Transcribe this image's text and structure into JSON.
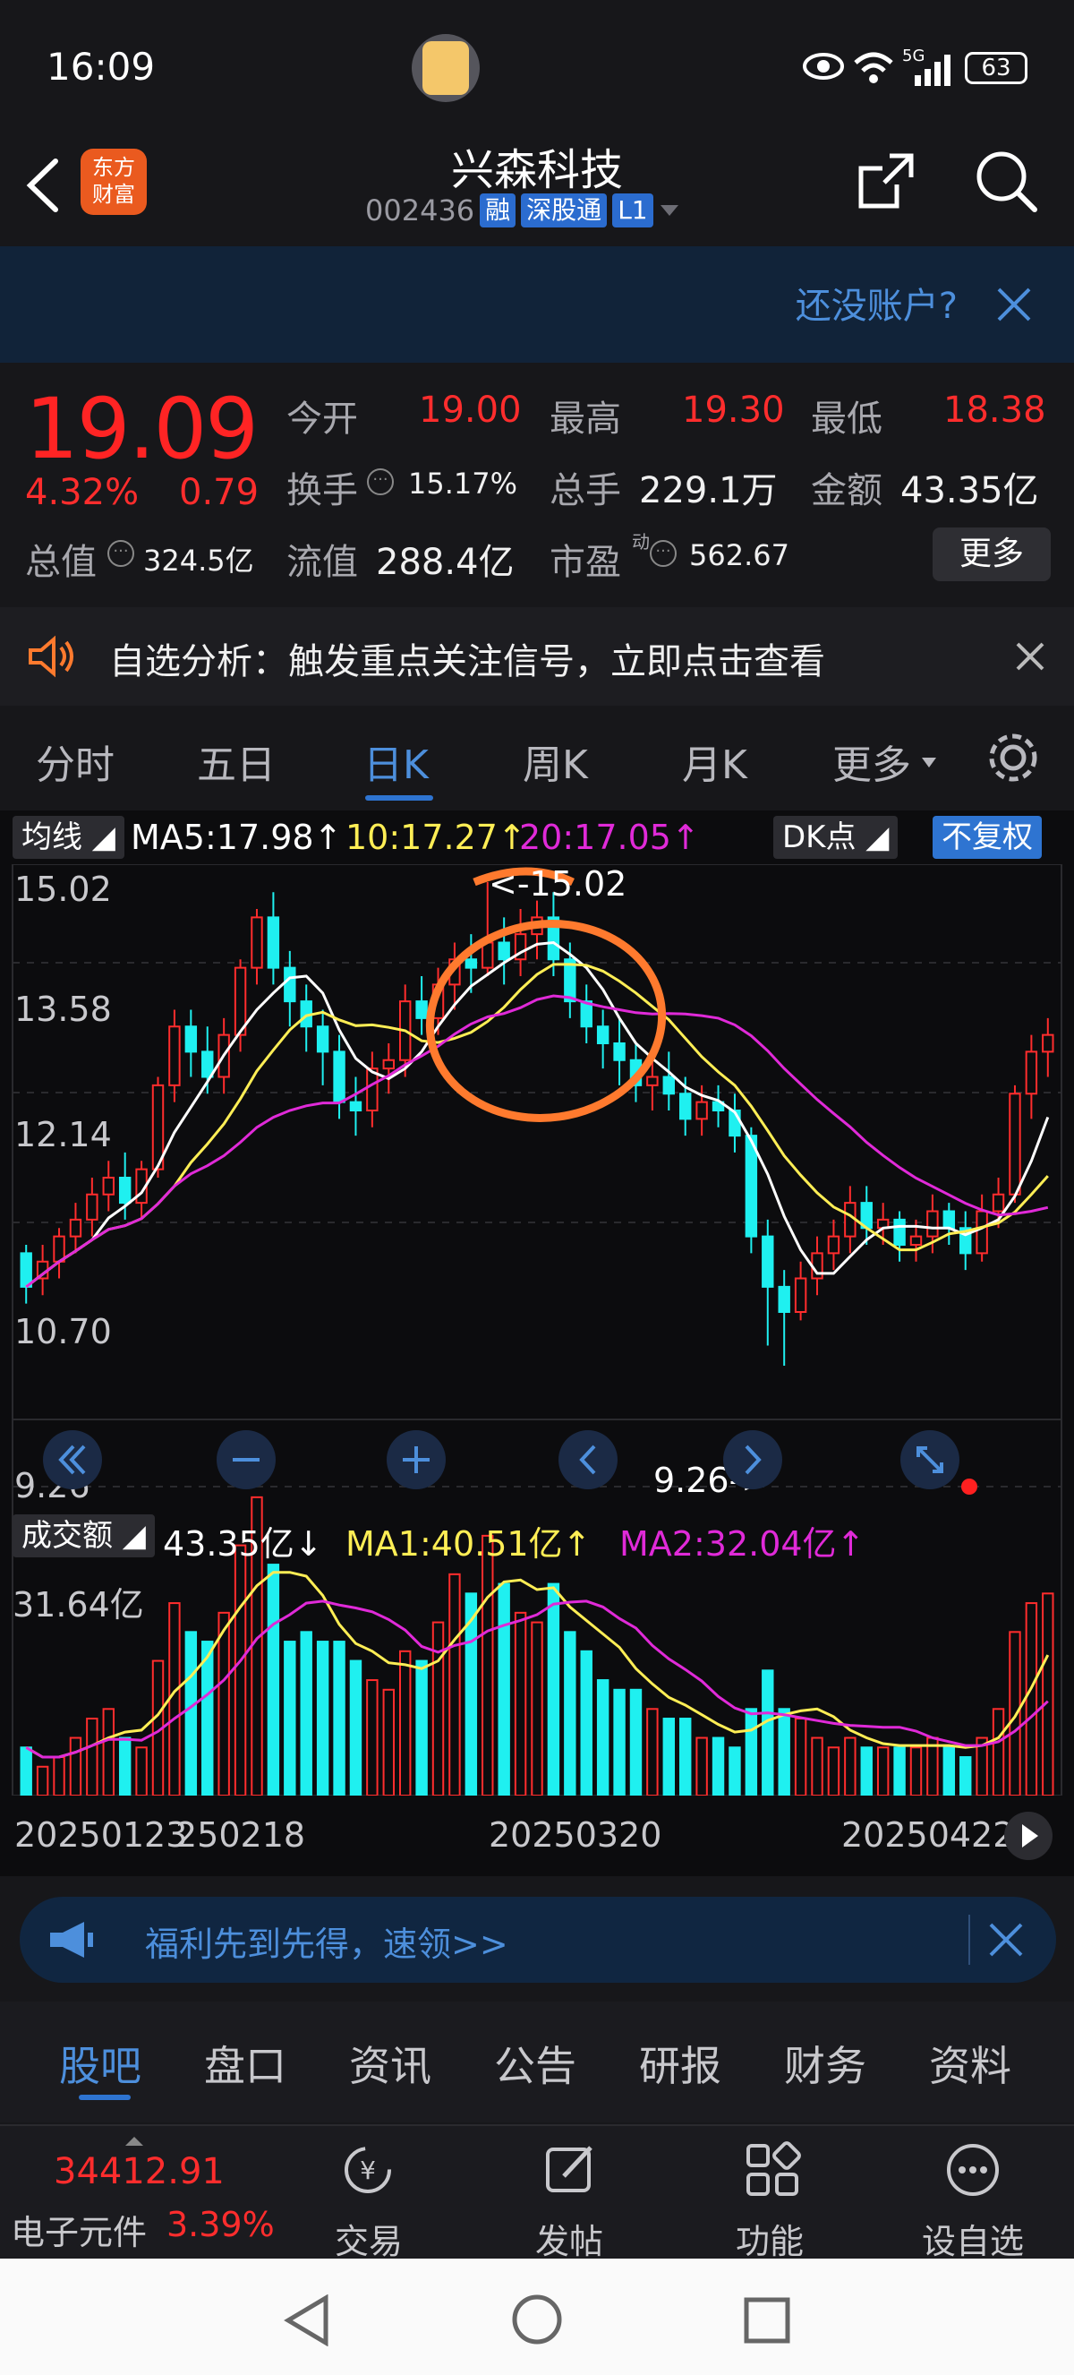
{
  "status": {
    "time": "16:09",
    "network": "5G",
    "battery": "63"
  },
  "header": {
    "title": "兴森科技",
    "code": "002436",
    "tags": [
      "融",
      "深股通",
      "L1"
    ],
    "logo_line1": "东方",
    "logo_line2": "财富"
  },
  "banner": {
    "text": "还没账户?"
  },
  "quote": {
    "price": "19.09",
    "change_pct": "4.32%",
    "change": "0.79",
    "open_label": "今开",
    "open": "19.00",
    "high_label": "最高",
    "high": "19.30",
    "low_label": "最低",
    "low": "18.38",
    "turnover_label": "换手",
    "turnover": "15.17%",
    "volume_label": "总手",
    "volume": "229.1万",
    "amount_label": "金额",
    "amount": "43.35亿",
    "mktcap_label": "总值",
    "mktcap": "324.5亿",
    "float_label": "流值",
    "float": "288.4亿",
    "pe_label": "市盈",
    "pe_sup": "动",
    "pe": "562.67",
    "more": "更多"
  },
  "analysis": {
    "text": "自选分析：触发重点关注信号，立即点击查看"
  },
  "tabs": [
    "分时",
    "五日",
    "日K",
    "周K",
    "月K",
    "更多"
  ],
  "active_tab": "日K",
  "chart": {
    "indicator_chip": "均线",
    "ma5": "MA5:17.98↑",
    "ma10": "10:17.27↑",
    "ma20": "20:17.05↑",
    "dk_chip": "DK点",
    "adjust_chip": "不复权",
    "y_labels": [
      "15.02",
      "13.58",
      "12.14",
      "10.70",
      "9.26"
    ],
    "high_marker": "<-15.02",
    "low_marker": "9.26->",
    "vol_chip": "成交额",
    "vol_value": "43.35亿↓",
    "vol_ma1": "MA1:40.51亿↑",
    "vol_ma2": "MA2:32.04亿↑",
    "vol_max": "31.64亿",
    "x_labels": [
      "20250123",
      "250218",
      "20250320",
      "20250422"
    ],
    "colors": {
      "up": "#ff2d2d",
      "down": "#1ff0f0",
      "ma5": "#ffffff",
      "ma10": "#ffee55",
      "ma20": "#e02ad8",
      "annotation": "#ff7a2e"
    }
  },
  "chart_data": {
    "type": "candlestick",
    "ylim": [
      9.26,
      15.02
    ],
    "candles": [
      [
        10.6,
        10.2,
        10.7,
        10.0
      ],
      [
        10.3,
        10.5,
        10.7,
        10.1
      ],
      [
        10.5,
        10.8,
        10.9,
        10.3
      ],
      [
        10.8,
        11.0,
        11.2,
        10.6
      ],
      [
        11.0,
        11.3,
        11.5,
        10.8
      ],
      [
        11.3,
        11.5,
        11.7,
        11.1
      ],
      [
        11.5,
        11.2,
        11.8,
        11.0
      ],
      [
        11.2,
        11.6,
        11.7,
        11.0
      ],
      [
        11.6,
        12.6,
        12.7,
        11.5
      ],
      [
        12.6,
        13.3,
        13.5,
        12.4
      ],
      [
        13.3,
        13.0,
        13.5,
        12.7
      ],
      [
        13.0,
        12.7,
        13.3,
        12.5
      ],
      [
        12.7,
        13.2,
        13.4,
        12.5
      ],
      [
        13.2,
        14.0,
        14.1,
        13.0
      ],
      [
        14.0,
        14.6,
        14.7,
        13.8
      ],
      [
        14.6,
        14.0,
        14.9,
        13.8
      ],
      [
        14.0,
        13.6,
        14.2,
        13.3
      ],
      [
        13.6,
        13.3,
        13.8,
        13.0
      ],
      [
        13.3,
        13.0,
        13.5,
        12.6
      ],
      [
        13.0,
        12.4,
        13.2,
        12.2
      ],
      [
        12.4,
        12.3,
        12.7,
        12.0
      ],
      [
        12.3,
        12.8,
        13.0,
        12.1
      ],
      [
        12.8,
        12.9,
        13.1,
        12.5
      ],
      [
        12.9,
        13.6,
        13.8,
        12.7
      ],
      [
        13.6,
        13.4,
        13.9,
        13.2
      ],
      [
        13.4,
        13.8,
        14.0,
        13.2
      ],
      [
        13.8,
        14.1,
        14.3,
        13.5
      ],
      [
        14.1,
        14.0,
        14.4,
        13.7
      ],
      [
        14.0,
        14.3,
        15.02,
        13.9
      ],
      [
        14.3,
        14.1,
        14.6,
        13.8
      ],
      [
        14.1,
        14.4,
        14.7,
        13.9
      ],
      [
        14.4,
        14.6,
        14.8,
        14.1
      ],
      [
        14.6,
        14.1,
        14.9,
        13.9
      ],
      [
        14.1,
        13.6,
        14.3,
        13.4
      ],
      [
        13.6,
        13.3,
        13.8,
        13.1
      ],
      [
        13.3,
        13.1,
        13.5,
        12.8
      ],
      [
        13.1,
        12.9,
        13.4,
        12.6
      ],
      [
        12.9,
        12.6,
        13.1,
        12.4
      ],
      [
        12.6,
        12.7,
        12.9,
        12.3
      ],
      [
        12.7,
        12.5,
        13.0,
        12.3
      ],
      [
        12.5,
        12.2,
        12.7,
        12.0
      ],
      [
        12.2,
        12.4,
        12.6,
        12.0
      ],
      [
        12.4,
        12.3,
        12.6,
        12.1
      ],
      [
        12.3,
        12.0,
        12.5,
        11.8
      ],
      [
        12.0,
        10.8,
        12.1,
        10.6
      ],
      [
        10.8,
        10.2,
        11.0,
        9.5
      ],
      [
        10.2,
        9.9,
        10.4,
        9.26
      ],
      [
        9.9,
        10.3,
        10.5,
        9.8
      ],
      [
        10.3,
        10.6,
        10.8,
        10.1
      ],
      [
        10.6,
        10.8,
        11.0,
        10.4
      ],
      [
        10.8,
        11.2,
        11.4,
        10.6
      ],
      [
        11.2,
        10.9,
        11.4,
        10.7
      ],
      [
        10.9,
        11.0,
        11.2,
        10.7
      ],
      [
        11.0,
        10.7,
        11.1,
        10.5
      ],
      [
        10.7,
        10.8,
        11.0,
        10.5
      ],
      [
        10.8,
        11.1,
        11.3,
        10.6
      ],
      [
        11.1,
        10.9,
        11.2,
        10.7
      ],
      [
        10.9,
        10.6,
        11.1,
        10.4
      ],
      [
        10.6,
        11.1,
        11.3,
        10.5
      ],
      [
        11.1,
        11.3,
        11.5,
        10.9
      ],
      [
        11.3,
        12.5,
        12.6,
        11.2
      ],
      [
        12.5,
        13.0,
        13.2,
        12.2
      ],
      [
        13.0,
        13.2,
        13.4,
        12.7
      ]
    ],
    "volume": [
      5,
      3,
      4,
      6,
      8,
      9,
      6,
      5,
      14,
      20,
      17,
      16,
      19,
      26,
      31,
      24,
      16,
      17,
      16,
      16,
      14,
      12,
      11,
      15,
      14,
      18,
      23,
      21,
      27,
      22,
      19,
      18,
      22,
      17,
      15,
      12,
      11,
      11,
      9,
      8,
      8,
      6,
      6,
      5,
      9,
      13,
      9,
      8,
      6,
      5,
      6,
      5,
      5,
      5,
      5,
      6,
      5,
      4,
      6,
      9,
      17,
      20,
      21
    ]
  }
}
